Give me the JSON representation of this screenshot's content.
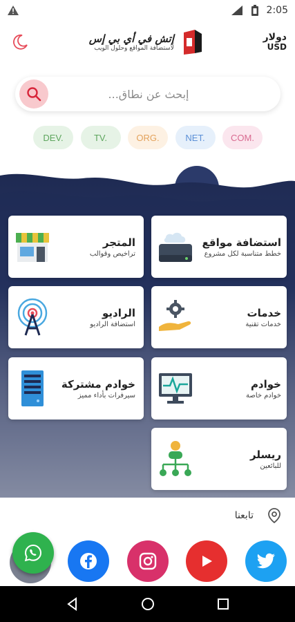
{
  "status_bar": {
    "time": "2:05"
  },
  "header": {
    "logo_title": "إتش في أي بي إس",
    "logo_subtitle": "لاستضافة المواقع وحلول الويب",
    "currency_ar": "دولار",
    "currency_en": "USD"
  },
  "search": {
    "placeholder": "إبحث عن نطاق..."
  },
  "tlds": [
    {
      "label": "DEV.",
      "bg": "#e6f3e6",
      "fg": "#5da55d"
    },
    {
      "label": "TV.",
      "bg": "#e6f3e6",
      "fg": "#5da55d"
    },
    {
      "label": "ORG.",
      "bg": "#fdf1e3",
      "fg": "#e3a25b"
    },
    {
      "label": "NET.",
      "bg": "#e6f0fb",
      "fg": "#5b8fd6"
    },
    {
      "label": "COM.",
      "bg": "#fbe6ee",
      "fg": "#d96a90"
    }
  ],
  "cards": {
    "hosting": {
      "title": "استضافة مواقع",
      "sub": "خطط متناسبة لكل مشروع"
    },
    "store": {
      "title": "المتجر",
      "sub": "تراخيص وقوالب"
    },
    "services": {
      "title": "خدمات",
      "sub": "خدمات تقنية"
    },
    "radio": {
      "title": "الراديو",
      "sub": "استضافة الراديو"
    },
    "servers": {
      "title": "خوادم",
      "sub": "خوادم خاصة"
    },
    "shared": {
      "title": "خوادم مشتركة",
      "sub": "سيرفرات بأداء مميز"
    },
    "reseller": {
      "title": "ريسلر",
      "sub": "للبائعين"
    }
  },
  "follow": {
    "label": "تابعنا"
  },
  "colors": {
    "accent": "#e74c5a",
    "wave_dark": "#1e2a52",
    "facebook": "#1877f2",
    "instagram": "#d8316a",
    "youtube": "#e62f2f",
    "twitter": "#1da1f2",
    "whatsapp": "#2fb24e"
  }
}
